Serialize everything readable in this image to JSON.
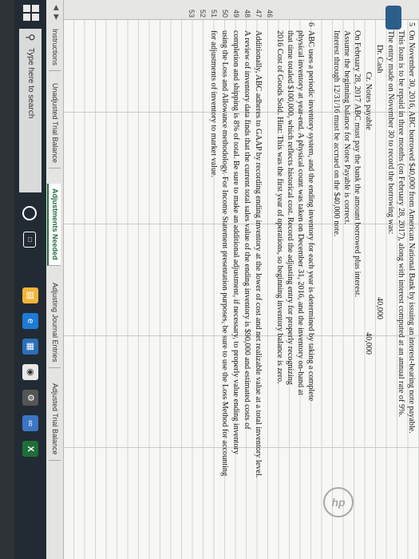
{
  "sheet": {
    "rows": [
      {
        "num": "5",
        "text": "On November 30, 2016, ABC borrowed $40,000 from American National Bank by issuing an interest-bearing note payable."
      },
      {
        "num": "",
        "text": "This loan is to be repaid in three months (on February 28, 2017), along with interest computed at an annual rate of 9%."
      },
      {
        "num": "",
        "text": "The entry made on November 30 to record the borrowing was:"
      },
      {
        "num": "",
        "text": "Dr. Cash"
      },
      {
        "num": "",
        "text": "Cr. Notes payable"
      },
      {
        "num": "",
        "text": "On February 28, 2017 ABC must pay the bank the amount borrowed plus interest."
      },
      {
        "num": "",
        "text": "Assume the beginning balance for Notes Payable is correct."
      },
      {
        "num": "",
        "text": "Interest through 12/31/16 must be accrued on the $40,000 note."
      },
      {
        "num": "6",
        "text": "ABC uses a periodic inventory system, and the ending inventory for each year is determined by taking a complete"
      },
      {
        "num": "",
        "text": "physical inventory at year-end. A physical count was taken on December 31, 2016, and the inventory on-hand at"
      },
      {
        "num": "",
        "text": "that time totaled $100,000, which reflects historical cost. Record the adjusting entry for properly recognizing"
      },
      {
        "num": "",
        "text": "2016 Cost of Goods Sold. Hint: This was the first year of operations, so beginning inventory balance is zero."
      },
      {
        "num": "",
        "text": "Additionally, ABC adheres to GAAP by recording ending inventory at the lower of cost and net realizable value at a total inventory level."
      },
      {
        "num": "",
        "text": "A review of inventory data finds that the current total sales value of the ending inventory is $90,000 and estimated costs of"
      },
      {
        "num": "",
        "text": "completion and shipping is 8% of total. Be sure to make an additional adjustment, if necessary, to properly value ending inventory"
      },
      {
        "num": "",
        "text": "using the Loss and Allowance methodology. For Income Statement presentation purposes, be sure to use the Loss Method for accounting"
      },
      {
        "num": "",
        "text": "for adjustments of inventory to market value."
      }
    ],
    "debit_amount": "40,000",
    "credit_amount": "40,000",
    "row_numbers": [
      "46",
      "47",
      "48",
      "49",
      "50",
      "51",
      "52",
      "53"
    ]
  },
  "tabs": [
    "Instructions",
    "Unadjusted Trial Balance",
    "Adjustments Needed",
    "Adjusting Journal Entries",
    "Adjusted Trial Balance"
  ],
  "active_tab": "Adjustments Needed",
  "taskbar": {
    "search_placeholder": "Type here to search"
  },
  "colors": {
    "excel_green": "#1e6e3a",
    "taskbar": "#222b33"
  }
}
